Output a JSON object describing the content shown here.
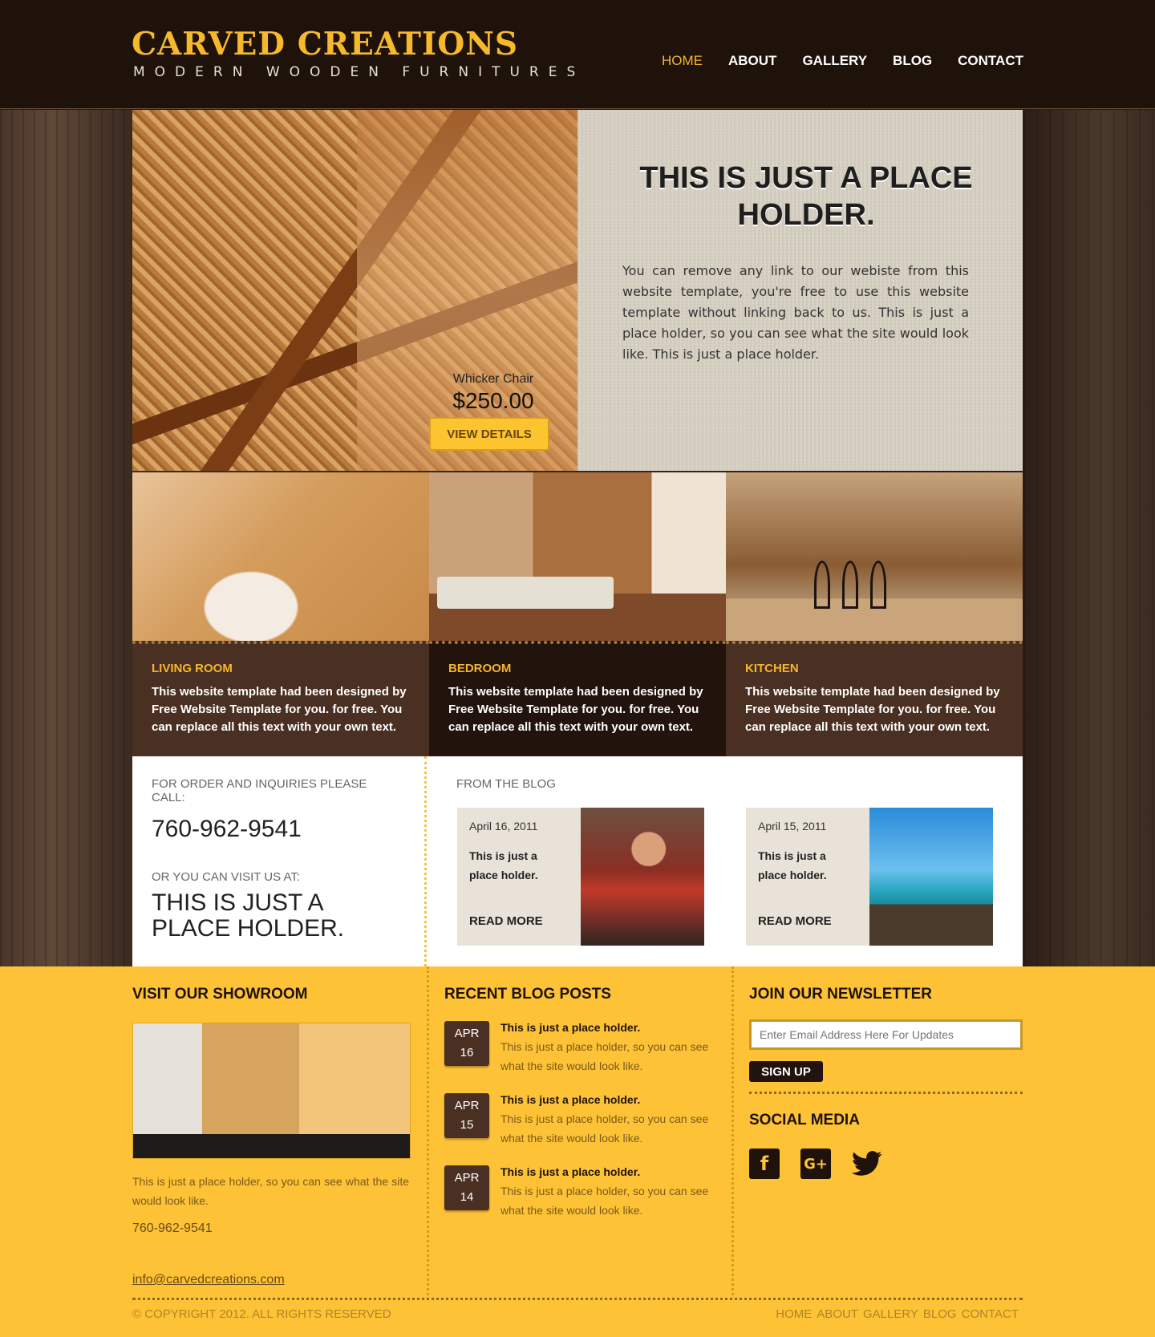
{
  "brand": {
    "title": "CARVED CREATIONS",
    "subtitle": "MODERN WOODEN FURNITURES",
    "accent_color": "#f7b52a",
    "dark_color": "#1e120b"
  },
  "nav": {
    "items": [
      {
        "label": "HOME",
        "active": true
      },
      {
        "label": "ABOUT"
      },
      {
        "label": "GALLERY"
      },
      {
        "label": "BLOG"
      },
      {
        "label": "CONTACT"
      }
    ]
  },
  "hero": {
    "product_name": "Whicker Chair",
    "product_price": "$250.00",
    "button_label": "VIEW DETAILS",
    "title": "THIS IS JUST A PLACE HOLDER.",
    "body": "You can remove any link to our webiste from this website template, you're free to use this website template without linking back to us. This is just a place holder, so you can see what the site would look like. This is just a place holder."
  },
  "rooms": [
    {
      "title": "LIVING ROOM",
      "text": "This website template had been designed by Free Website Template for you. for free. You can replace all this text with your own text."
    },
    {
      "title": "BEDROOM",
      "text": "This website template had been designed by Free Website Template for you. for free. You can replace all this text with your own text."
    },
    {
      "title": "KITCHEN",
      "text": "This website template had been designed by Free Website Template for you. for free. You can replace all this text with your own text."
    }
  ],
  "contact": {
    "order_label": "FOR ORDER AND INQUIRIES PLEASE CALL:",
    "phone": "760-962-9541",
    "visit_label": "OR YOU CAN VISIT US AT:",
    "visit_text": "THIS IS JUST A PLACE HOLDER."
  },
  "blog": {
    "heading": "FROM THE BLOG",
    "cards": [
      {
        "date": "April 16, 2011",
        "text": "This is just a place holder.",
        "read_more": "READ MORE",
        "image": "craftsman-photo"
      },
      {
        "date": "April 15, 2011",
        "text": "This is just a place holder.",
        "read_more": "READ MORE",
        "image": "beach-patio-photo"
      }
    ]
  },
  "footer": {
    "showroom": {
      "title": "VISIT OUR SHOWROOM",
      "desc": "This is just a place holder, so you can see what the site would look like.",
      "phone": "760-962-9541",
      "email": "info@carvedcreations.com"
    },
    "recent": {
      "title": "RECENT BLOG POSTS",
      "posts": [
        {
          "month": "APR",
          "day": "16",
          "title": "This is just a place holder.",
          "desc": "This is just a place holder, so you can see what the site would look like."
        },
        {
          "month": "APR",
          "day": "15",
          "title": "This is just a place holder.",
          "desc": "This is just a place holder, so you can see what the site would look like."
        },
        {
          "month": "APR",
          "day": "14",
          "title": "This is just a place holder.",
          "desc": "This is just a place holder, so you can see what the site would look like."
        }
      ]
    },
    "newsletter": {
      "title": "JOIN OUR NEWSLETTER",
      "placeholder": "Enter Email Address Here For Updates",
      "button": "SIGN UP",
      "social_title": "SOCIAL MEDIA",
      "social": [
        "facebook-icon",
        "google-plus-icon",
        "twitter-icon"
      ]
    },
    "copyright": "© COPYRIGHT 2012. ALL RIGHTS RESERVED",
    "nav": [
      "HOME",
      "ABOUT",
      "GALLERY",
      "BLOG",
      "CONTACT"
    ]
  }
}
